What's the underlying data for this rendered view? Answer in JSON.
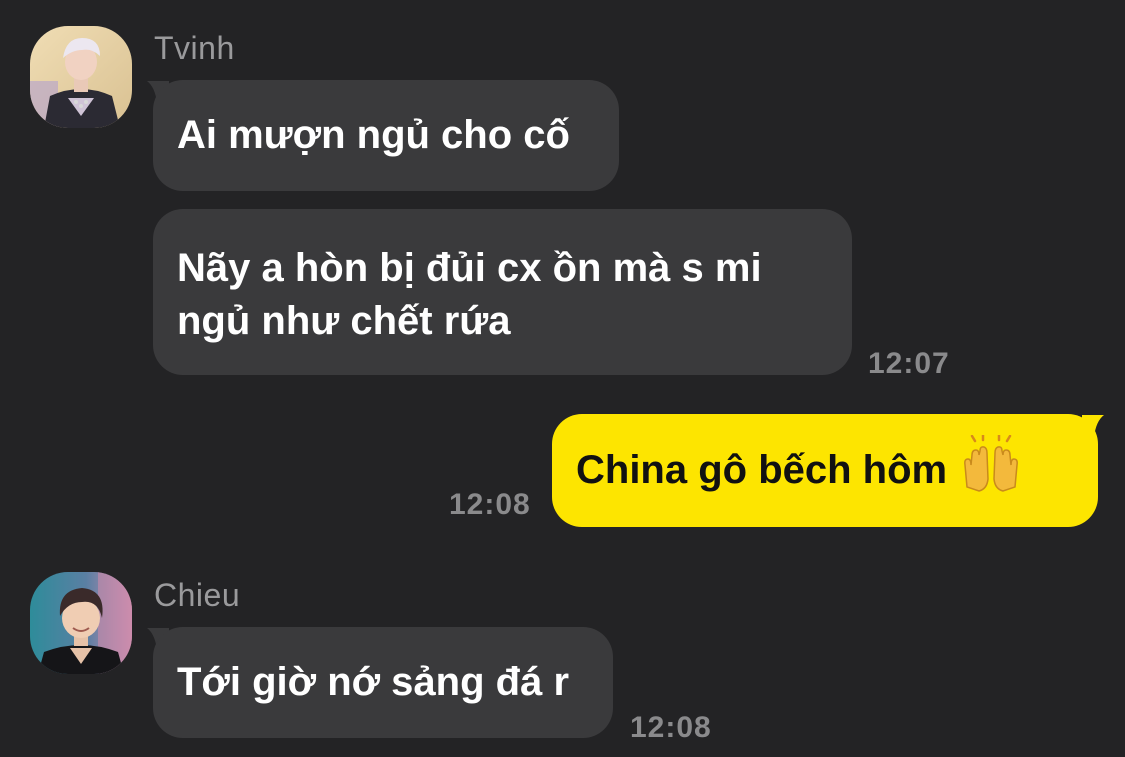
{
  "theme": {
    "background": "#232325",
    "incoming_bubble": "#3a3a3c",
    "outgoing_bubble": "#fde500",
    "name_color": "#9a9a9c",
    "time_color": "#8a8a8c"
  },
  "messages": [
    {
      "sender": "Tvinh",
      "avatar_icon": "user-avatar-tvinh",
      "bubbles": [
        "Ai mượn ngủ cho cố",
        "Nãy a hòn bị đủi cx ồn mà s mi ngủ như chết rứa"
      ],
      "time": "12:07"
    },
    {
      "sender": "me",
      "bubbles": [
        "China gô bếch hôm"
      ],
      "emoji": "raising-hands-emoji",
      "time": "12:08"
    },
    {
      "sender": "Chieu",
      "avatar_icon": "user-avatar-chieu",
      "bubbles": [
        "Tới giờ nớ sảng đá r"
      ],
      "time": "12:08"
    }
  ]
}
